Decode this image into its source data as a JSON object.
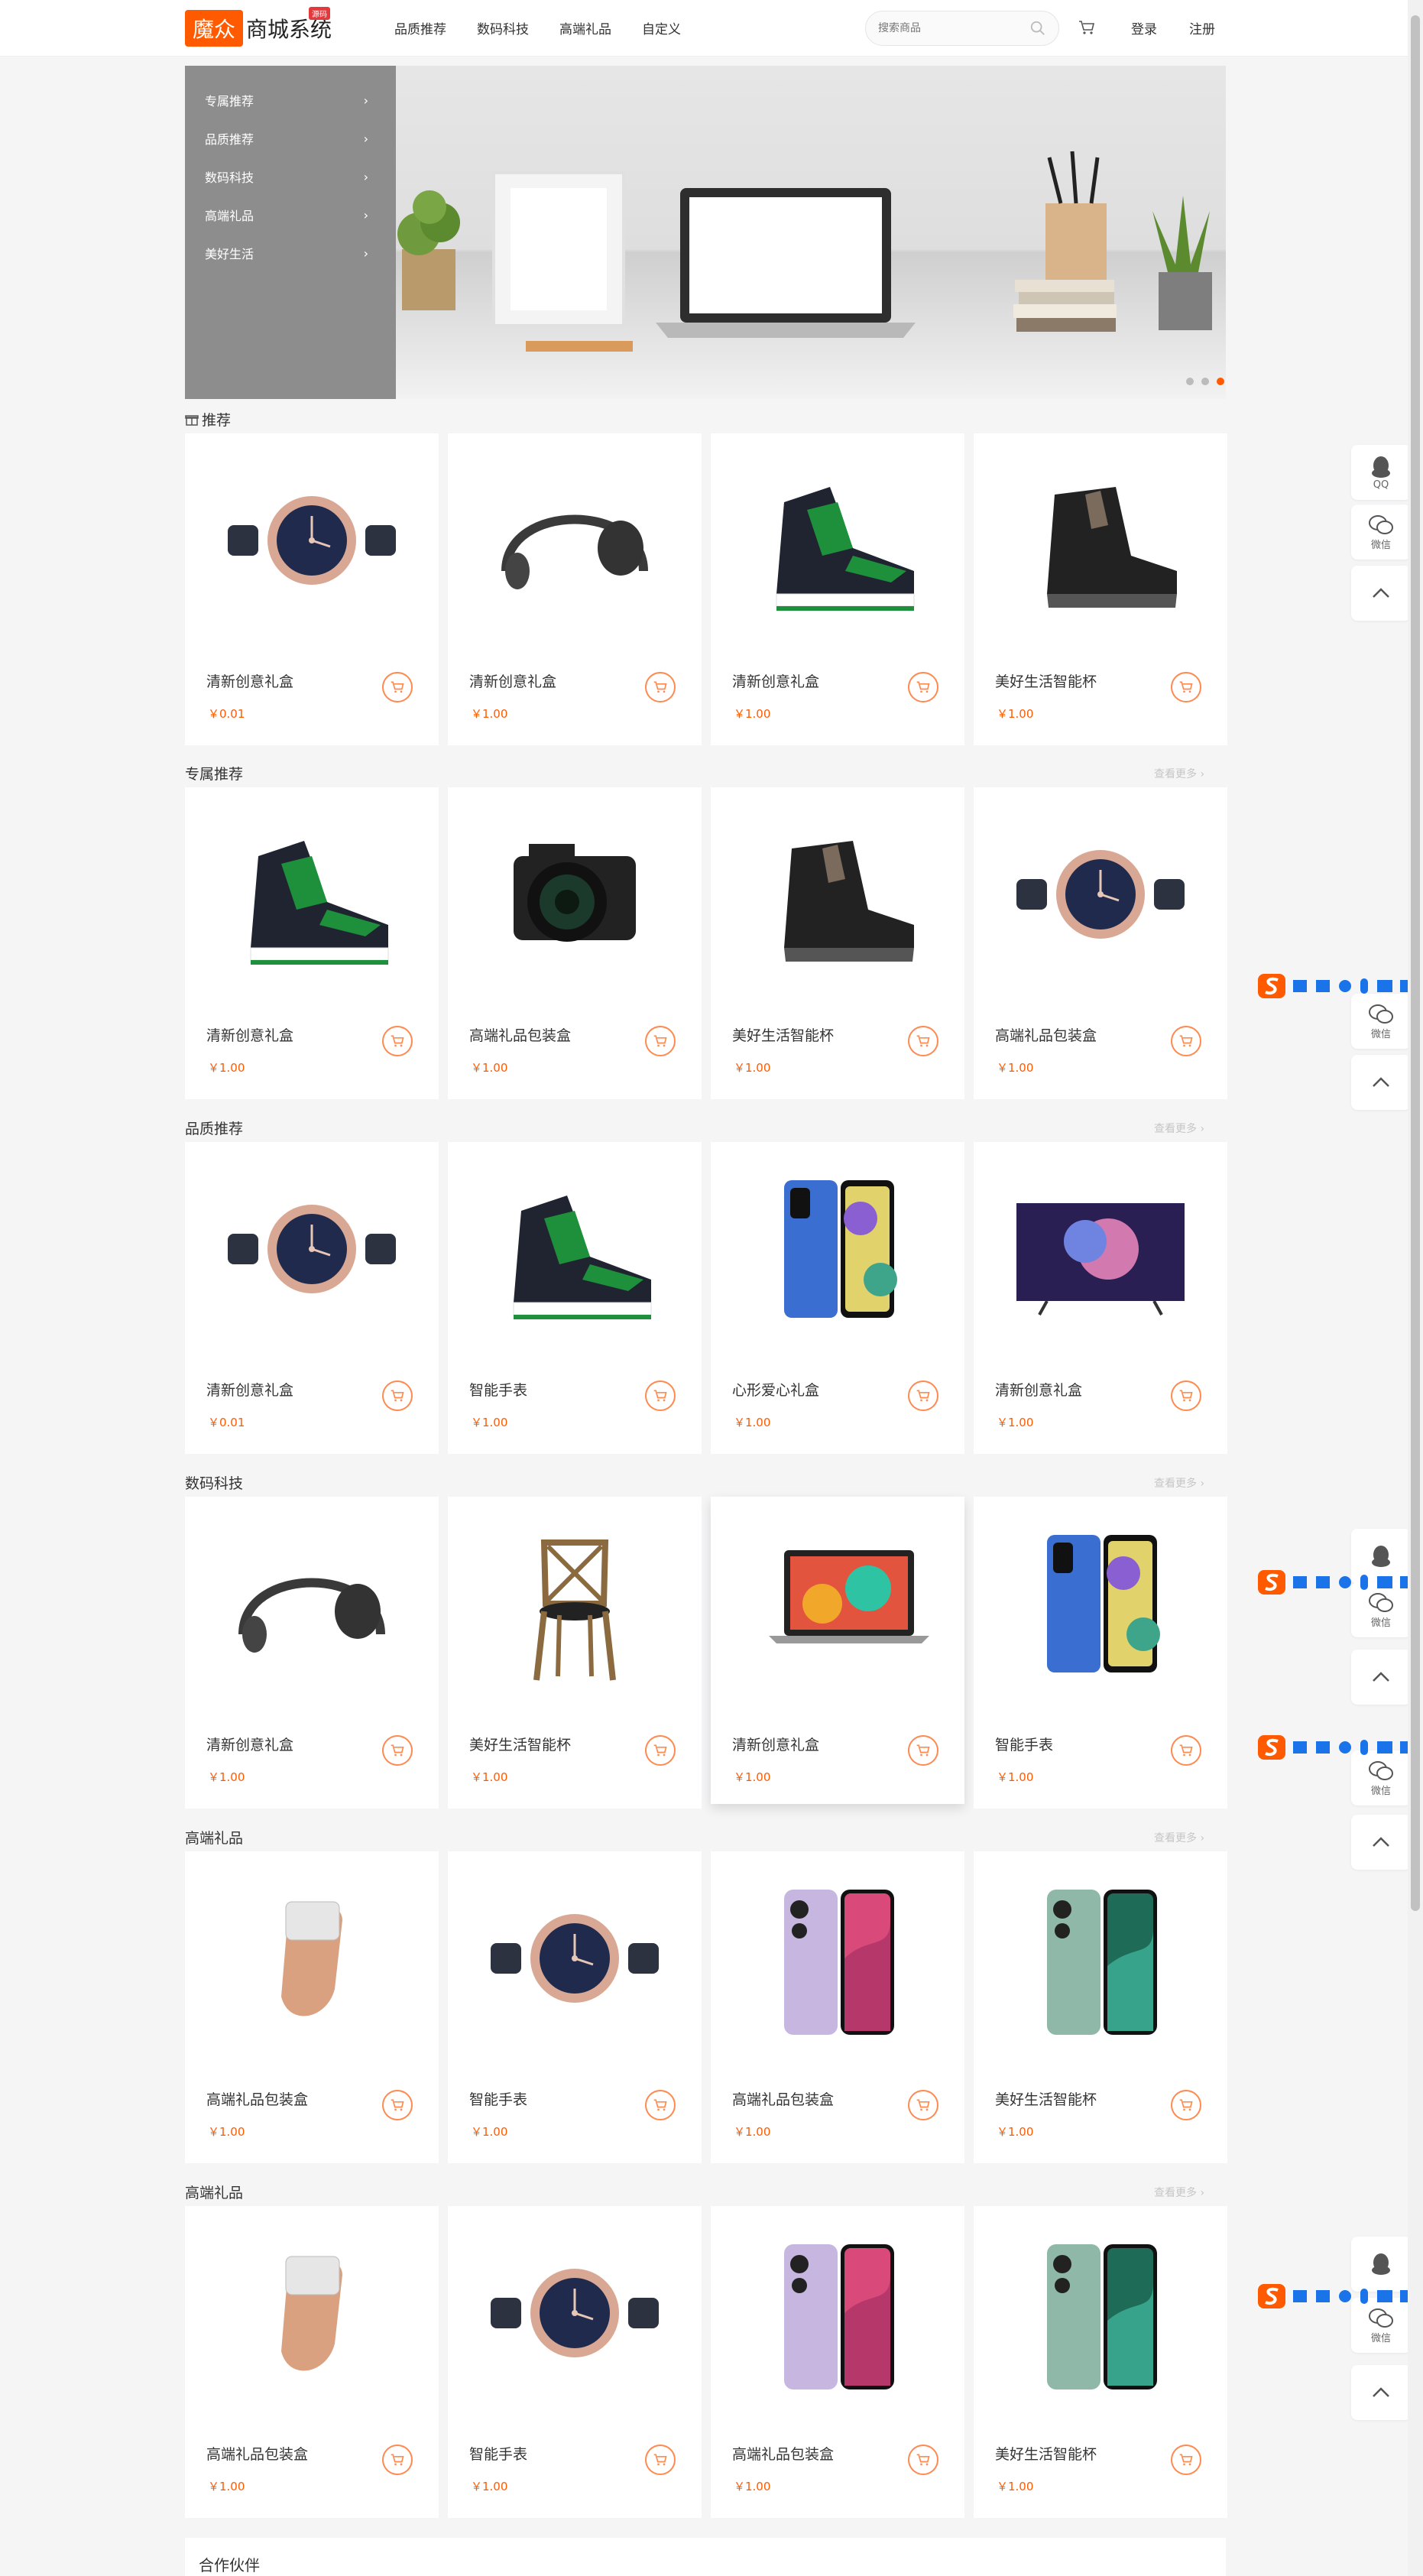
{
  "header": {
    "logo_badge": "魔众",
    "logo_text": "商城系统",
    "logo_tag": "源码",
    "nav": [
      "品质推荐",
      "数码科技",
      "高端礼品",
      "自定义"
    ],
    "search_placeholder": "搜索商品",
    "login": "登录",
    "register": "注册"
  },
  "banner": {
    "menu": [
      "专属推荐",
      "品质推荐",
      "数码科技",
      "高端礼品",
      "美好生活"
    ],
    "slide_count": 3,
    "active_slide": 3
  },
  "sections": [
    {
      "title": "推荐",
      "more": "",
      "products": [
        {
          "name": "清新创意礼盒",
          "price": "￥0.01",
          "icon": "watch"
        },
        {
          "name": "清新创意礼盒",
          "price": "￥1.00",
          "icon": "headphones"
        },
        {
          "name": "清新创意礼盒",
          "price": "￥1.00",
          "icon": "sneaker"
        },
        {
          "name": "美好生活智能杯",
          "price": "￥1.00",
          "icon": "boot"
        }
      ]
    },
    {
      "title": "专属推荐",
      "more": "查看更多 ›",
      "products": [
        {
          "name": "清新创意礼盒",
          "price": "￥1.00",
          "icon": "sneaker"
        },
        {
          "name": "高端礼品包装盒",
          "price": "￥1.00",
          "icon": "camera"
        },
        {
          "name": "美好生活智能杯",
          "price": "￥1.00",
          "icon": "boot"
        },
        {
          "name": "高端礼品包装盒",
          "price": "￥1.00",
          "icon": "watch"
        }
      ]
    },
    {
      "title": "品质推荐",
      "more": "查看更多 ›",
      "products": [
        {
          "name": "清新创意礼盒",
          "price": "￥0.01",
          "icon": "watch"
        },
        {
          "name": "智能手表",
          "price": "￥1.00",
          "icon": "sneaker"
        },
        {
          "name": "心形爱心礼盒",
          "price": "￥1.00",
          "icon": "phone-blue"
        },
        {
          "name": "清新创意礼盒",
          "price": "￥1.00",
          "icon": "tv"
        }
      ]
    },
    {
      "title": "数码科技",
      "more": "查看更多 ›",
      "products": [
        {
          "name": "清新创意礼盒",
          "price": "￥1.00",
          "icon": "headphones"
        },
        {
          "name": "美好生活智能杯",
          "price": "￥1.00",
          "icon": "chair"
        },
        {
          "name": "清新创意礼盒",
          "price": "￥1.00",
          "icon": "laptop"
        },
        {
          "name": "智能手表",
          "price": "￥1.00",
          "icon": "phone-blue"
        }
      ]
    },
    {
      "title": "高端礼品",
      "more": "查看更多 ›",
      "products": [
        {
          "name": "高端礼品包装盒",
          "price": "￥1.00",
          "icon": "bracelet"
        },
        {
          "name": "智能手表",
          "price": "￥1.00",
          "icon": "watch"
        },
        {
          "name": "高端礼品包装盒",
          "price": "￥1.00",
          "icon": "phone-pink"
        },
        {
          "name": "美好生活智能杯",
          "price": "￥1.00",
          "icon": "phone-green"
        }
      ]
    },
    {
      "title": "高端礼品",
      "more": "查看更多 ›",
      "products": [
        {
          "name": "高端礼品包装盒",
          "price": "￥1.00",
          "icon": "bracelet"
        },
        {
          "name": "智能手表",
          "price": "￥1.00",
          "icon": "watch"
        },
        {
          "name": "高端礼品包装盒",
          "price": "￥1.00",
          "icon": "phone-pink"
        },
        {
          "name": "美好生活智能杯",
          "price": "￥1.00",
          "icon": "phone-green"
        }
      ]
    }
  ],
  "partners_title": "合作伙伴",
  "float_tools": {
    "qq": "QQ",
    "wechat": "微信"
  },
  "colors": {
    "accent": "#ff5a00",
    "menu_bg": "#8e8d8d",
    "page_bg": "#f5f5f6"
  }
}
